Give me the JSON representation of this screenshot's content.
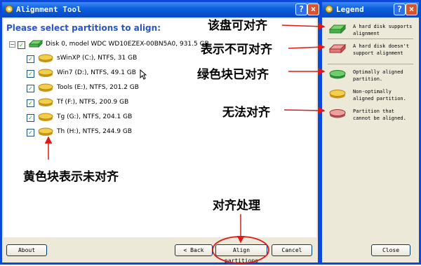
{
  "main_window": {
    "title": "Alignment Tool",
    "heading": "Please select partitions to align:",
    "disk": {
      "label": "Disk 0, model WDC WD10EZEX-00BN5A0, 931.5 GB"
    },
    "partitions": [
      {
        "label": "sWinXP (C:), NTFS, 31 GB"
      },
      {
        "label": "Win7 (D:), NTFS, 49.1 GB"
      },
      {
        "label": "Tools (E:), NTFS, 201.2 GB"
      },
      {
        "label": "Tf (F:), NTFS, 200.9 GB"
      },
      {
        "label": "Tg (G:), NTFS, 204.1 GB"
      },
      {
        "label": "Th (H:), NTFS, 244.9 GB"
      }
    ],
    "buttons": {
      "about": "About",
      "back": "< Back",
      "align": "Align partitions",
      "cancel": "Cancel"
    },
    "title_buttons": {
      "help": "?",
      "close": "×"
    }
  },
  "legend_window": {
    "title": "Legend",
    "items": [
      {
        "text": "A hard disk supports alignment",
        "icon": "green-disk-icon"
      },
      {
        "text": "A hard disk doesn't support alignment",
        "icon": "red-disk-icon"
      },
      {
        "text": "Optimally aligned partition.",
        "icon": "green-partition-icon"
      },
      {
        "text": "Non-optimally aligned partition.",
        "icon": "yellow-partition-icon"
      },
      {
        "text": "Partition that cannot be aligned.",
        "icon": "red-partition-icon"
      }
    ],
    "close_button": "Close",
    "title_buttons": {
      "help": "?",
      "close": "×"
    }
  },
  "annotations": {
    "disk_can_align": "该盘可对齐",
    "disk_cannot_align": "表示不可对齐",
    "green_aligned": "绿色块已对齐",
    "cannot_align": "无法对齐",
    "yellow_not_aligned": "黄色块表示未对齐",
    "align_process": "对齐处理"
  },
  "colors": {
    "xp_blue": "#0b4ad8",
    "heading_blue": "#2a55c4",
    "annotation_red": "#e01818",
    "partition_yellow": "#e8bd2a",
    "partition_green": "#47b44a",
    "partition_red": "#e07a7a"
  }
}
